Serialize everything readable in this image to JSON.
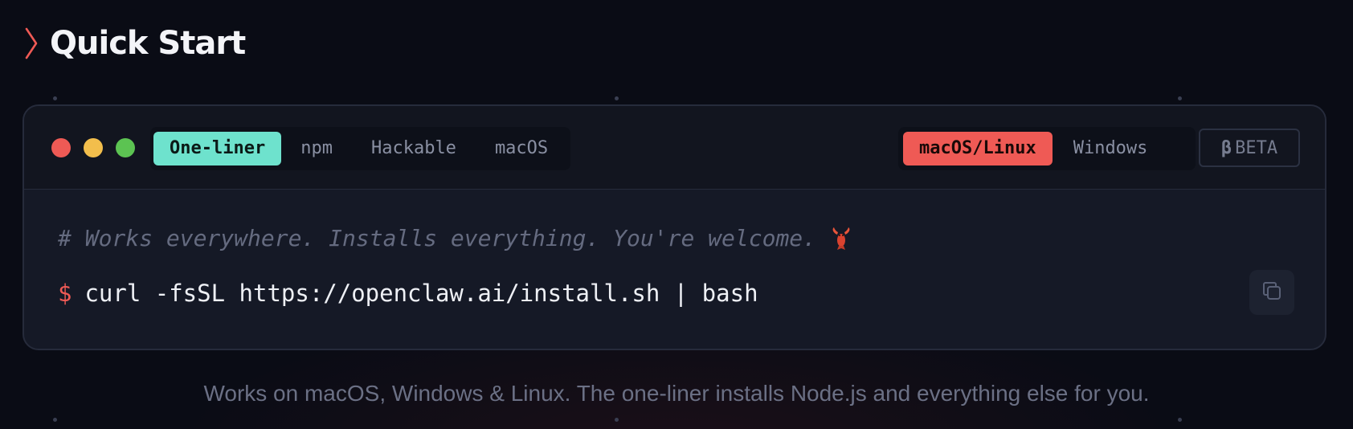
{
  "section": {
    "title": "Quick Start",
    "chevron_icon": "chevron-right-icon",
    "accent_color": "#ef5a55"
  },
  "terminal": {
    "window_controls": [
      "close",
      "minimize",
      "maximize"
    ],
    "tabs": [
      {
        "label": "One-liner",
        "active": true
      },
      {
        "label": "npm",
        "active": false
      },
      {
        "label": "Hackable",
        "active": false
      },
      {
        "label": "macOS",
        "active": false
      }
    ],
    "os_options": [
      {
        "label": "macOS/Linux",
        "active": true
      },
      {
        "label": "Windows",
        "active": false
      }
    ],
    "beta_badge": {
      "symbol": "β",
      "label": "BETA"
    },
    "comment": "# Works everywhere. Installs everything. You're welcome.",
    "comment_icon": "lobster-icon",
    "prompt": "$",
    "command": "curl -fsSL https://openclaw.ai/install.sh | bash",
    "copy_icon": "copy-icon"
  },
  "footnote": "Works on macOS, Windows & Linux. The one-liner installs Node.js and everything else for you.",
  "colors": {
    "active_tab": "#6ee2cd",
    "active_os": "#ef5a55",
    "background": "#0a0c15"
  }
}
